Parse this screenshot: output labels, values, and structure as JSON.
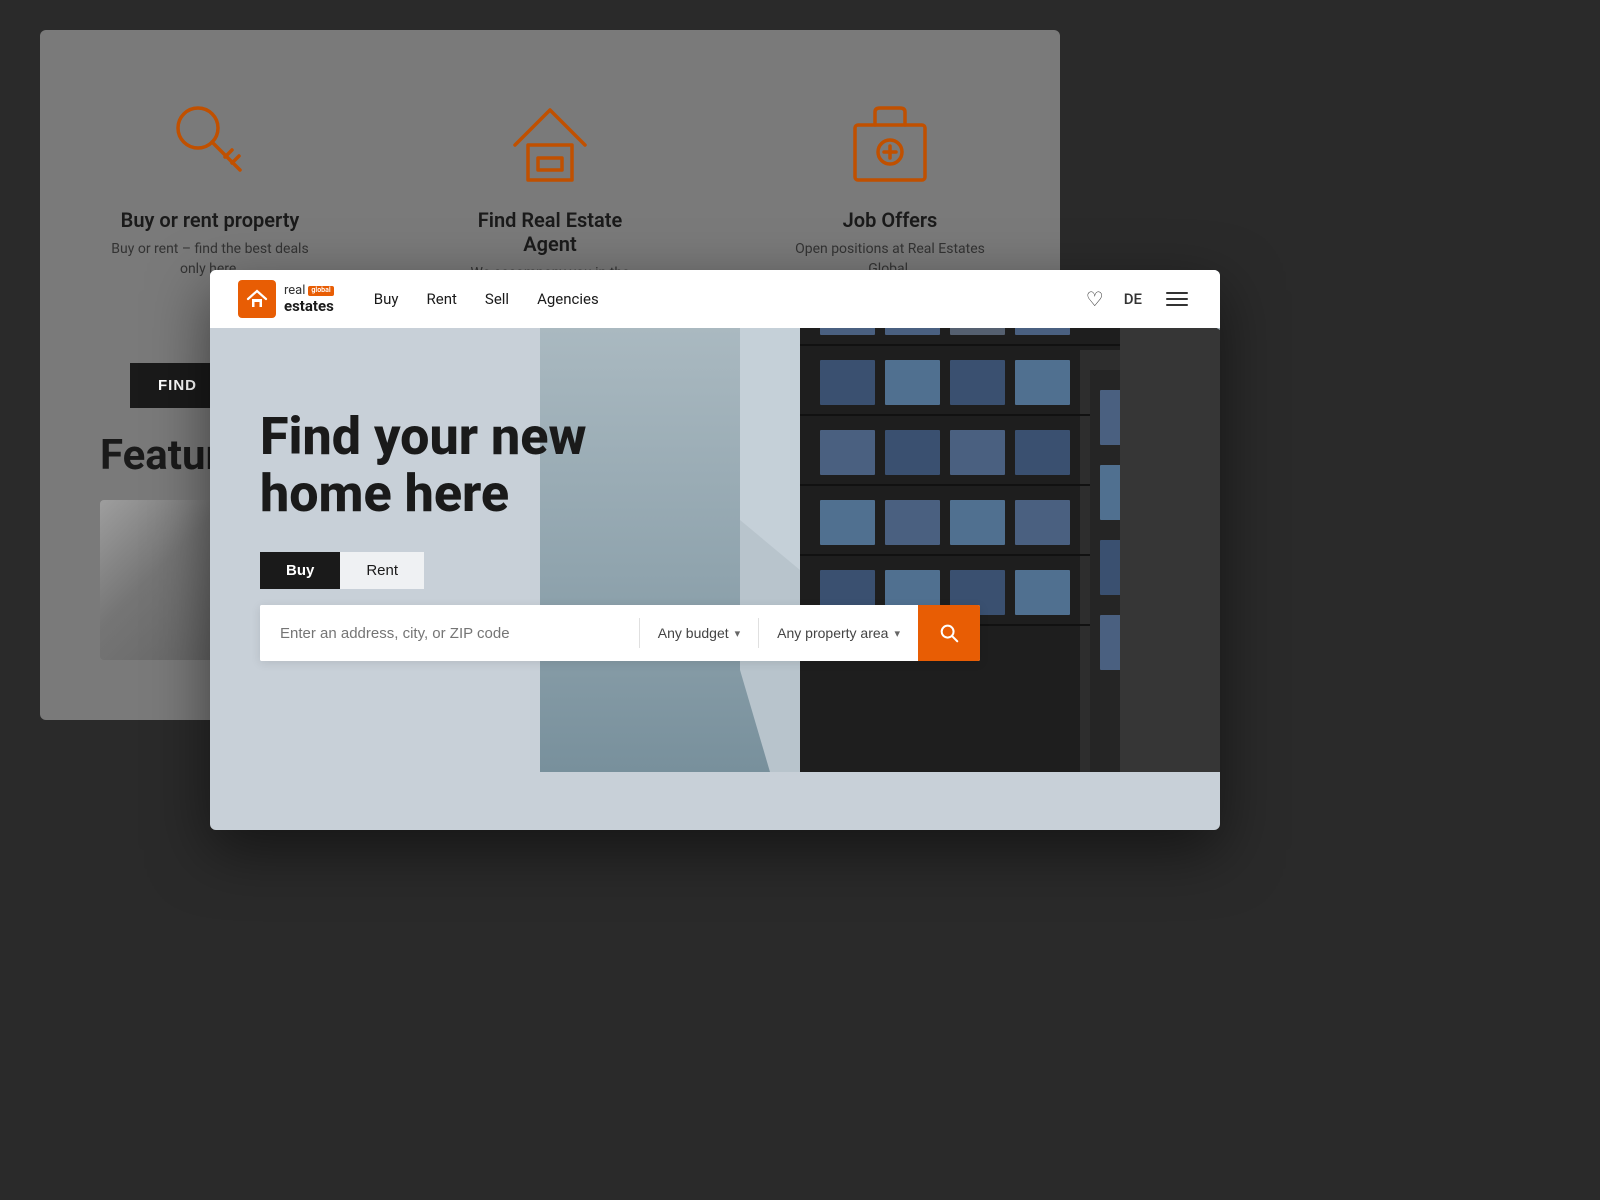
{
  "background": {
    "icons": [
      {
        "id": "buy-rent",
        "title": "Buy or rent property",
        "desc": "Buy or rent – find the best deals only here."
      },
      {
        "id": "agent",
        "title": "Find Real Estate Agent",
        "desc": "We accompany you in the search for the most suitable property."
      },
      {
        "id": "jobs",
        "title": "Job Offers",
        "desc": "Open positions at Real Estates Global."
      }
    ],
    "find_btn": "FIND",
    "featured_title": "Featured"
  },
  "navbar": {
    "logo_real": "real",
    "logo_global": "global",
    "logo_estates": "estates",
    "nav_links": [
      "Buy",
      "Rent",
      "Sell",
      "Agencies"
    ],
    "lang": "DE"
  },
  "hero": {
    "title_line1": "Find your new",
    "title_line2": "home here",
    "tab_buy": "Buy",
    "tab_rent": "Rent",
    "search_placeholder": "Enter an address, city, or ZIP code",
    "budget_label": "Any budget",
    "area_label": "Any property area"
  }
}
